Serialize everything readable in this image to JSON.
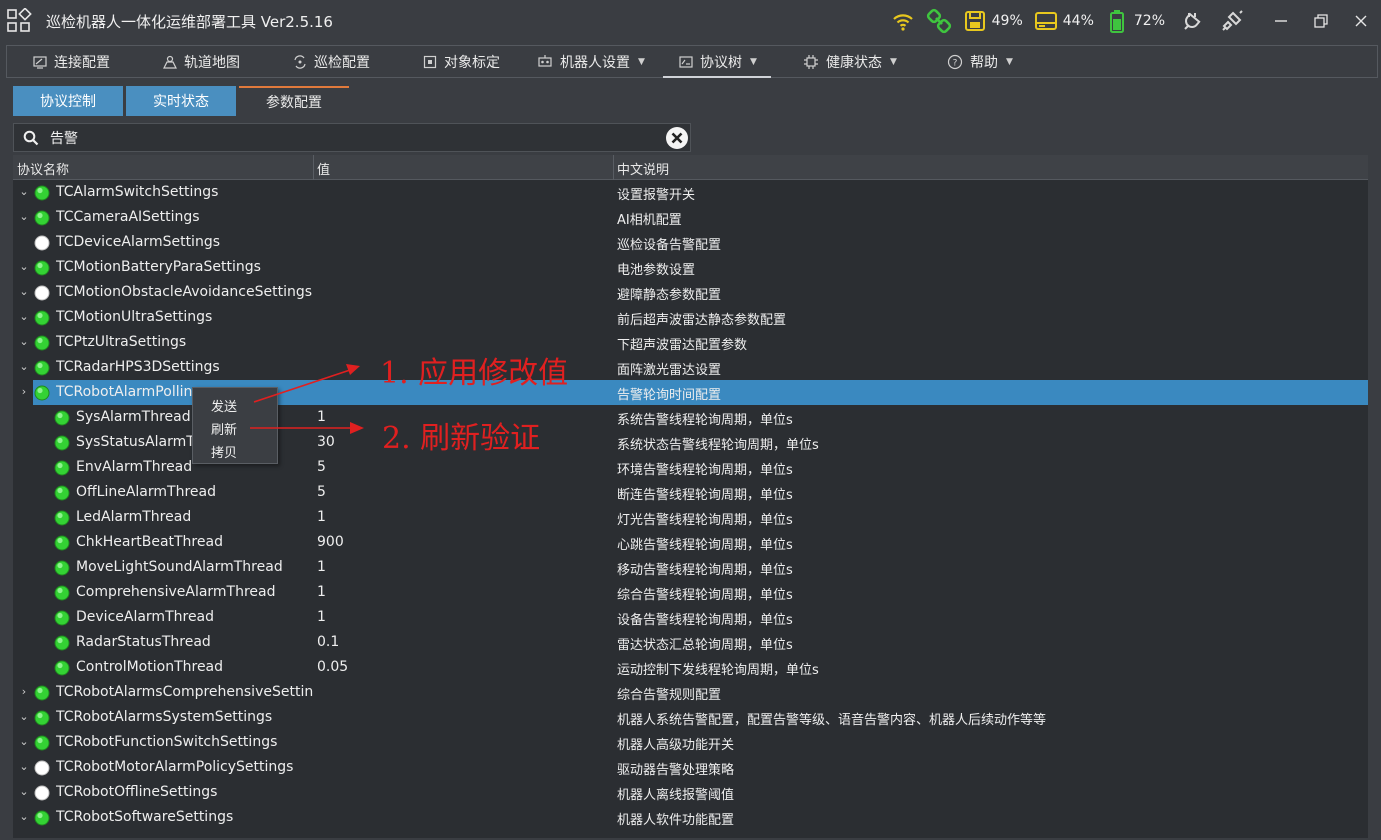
{
  "app": {
    "title": "巡检机器人一体化运维部署工具  Ver2.5.16",
    "logo_icon": "app-grid-logo-icon"
  },
  "status": {
    "wifi_icon": "wifi-signal-icon",
    "link_icon": "link-chain-icon",
    "disk_percent": "49%",
    "storage_percent": "44%",
    "battery_percent": "72%",
    "colors": {
      "green": "#3fc43f",
      "yellow": "#e8c81e",
      "gray": "#c8c8c8"
    }
  },
  "nav": [
    {
      "label": "连接配置",
      "icon": "connection-config-icon"
    },
    {
      "label": "轨道地图",
      "icon": "track-map-icon"
    },
    {
      "label": "巡检配置",
      "icon": "inspection-config-icon"
    },
    {
      "label": "对象标定",
      "icon": "object-calibration-icon"
    },
    {
      "label": "机器人设置",
      "icon": "robot-settings-icon"
    },
    {
      "label": "协议树",
      "icon": "protocol-tree-icon"
    },
    {
      "label": "健康状态",
      "icon": "health-status-icon"
    },
    {
      "label": "帮助",
      "icon": "help-icon"
    }
  ],
  "subtabs": [
    {
      "label": "协议控制"
    },
    {
      "label": "实时状态"
    },
    {
      "label": "参数配置"
    }
  ],
  "search": {
    "value": "告警",
    "placeholder": ""
  },
  "columns": {
    "name": "协议名称",
    "value": "值",
    "desc": "中文说明"
  },
  "rows": [
    {
      "level": 0,
      "expand": "down",
      "status": "green",
      "name": "TCAlarmSwitchSettings",
      "value": "",
      "desc": "设置报警开关"
    },
    {
      "level": 0,
      "expand": "down",
      "status": "green",
      "name": "TCCameraAISettings",
      "value": "",
      "desc": "AI相机配置"
    },
    {
      "level": 0,
      "expand": "",
      "status": "white",
      "name": "TCDeviceAlarmSettings",
      "value": "",
      "desc": "巡检设备告警配置"
    },
    {
      "level": 0,
      "expand": "down",
      "status": "green",
      "name": "TCMotionBatteryParaSettings",
      "value": "",
      "desc": "电池参数设置"
    },
    {
      "level": 0,
      "expand": "down",
      "status": "white",
      "name": "TCMotionObstacleAvoidanceSettings",
      "value": "",
      "desc": "避障静态参数配置"
    },
    {
      "level": 0,
      "expand": "down",
      "status": "green",
      "name": "TCMotionUltraSettings",
      "value": "",
      "desc": "前后超声波雷达静态参数配置"
    },
    {
      "level": 0,
      "expand": "down",
      "status": "green",
      "name": "TCPtzUltraSettings",
      "value": "",
      "desc": "下超声波雷达配置参数"
    },
    {
      "level": 0,
      "expand": "down",
      "status": "green",
      "name": "TCRadarHPS3DSettings",
      "value": "",
      "desc": "面阵激光雷达设置"
    },
    {
      "level": 0,
      "expand": "right",
      "status": "green",
      "name": "TCRobotAlarmPollin",
      "value": "",
      "desc": "告警轮询时间配置",
      "selected": true
    },
    {
      "level": 1,
      "expand": "",
      "status": "green",
      "name": "SysAlarmThread",
      "value": "1",
      "desc": "系统告警线程轮询周期，单位s"
    },
    {
      "level": 1,
      "expand": "",
      "status": "green",
      "name": "SysStatusAlarmTh",
      "value": "30",
      "desc": "系统状态告警线程轮询周期，单位s"
    },
    {
      "level": 1,
      "expand": "",
      "status": "green",
      "name": "EnvAlarmThread",
      "value": "5",
      "desc": "环境告警线程轮询周期，单位s"
    },
    {
      "level": 1,
      "expand": "",
      "status": "green",
      "name": "OffLineAlarmThread",
      "value": "5",
      "desc": "断连告警线程轮询周期，单位s"
    },
    {
      "level": 1,
      "expand": "",
      "status": "green",
      "name": "LedAlarmThread",
      "value": "1",
      "desc": "灯光告警线程轮询周期，单位s"
    },
    {
      "level": 1,
      "expand": "",
      "status": "green",
      "name": "ChkHeartBeatThread",
      "value": "900",
      "desc": "心跳告警线程轮询周期，单位s"
    },
    {
      "level": 1,
      "expand": "",
      "status": "green",
      "name": "MoveLightSoundAlarmThread",
      "value": "1",
      "desc": "移动告警线程轮询周期，单位s"
    },
    {
      "level": 1,
      "expand": "",
      "status": "green",
      "name": "ComprehensiveAlarmThread",
      "value": "1",
      "desc": "综合告警线程轮询周期，单位s"
    },
    {
      "level": 1,
      "expand": "",
      "status": "green",
      "name": "DeviceAlarmThread",
      "value": "1",
      "desc": "设备告警线程轮询周期，单位s"
    },
    {
      "level": 1,
      "expand": "",
      "status": "green",
      "name": "RadarStatusThread",
      "value": "0.1",
      "desc": "雷达状态汇总轮询周期，单位s"
    },
    {
      "level": 1,
      "expand": "",
      "status": "green",
      "name": "ControlMotionThread",
      "value": "0.05",
      "desc": "运动控制下发线程轮询周期，单位s"
    },
    {
      "level": 0,
      "expand": "right",
      "status": "green",
      "name": "TCRobotAlarmsComprehensiveSettings",
      "value": "",
      "desc": "综合告警规则配置"
    },
    {
      "level": 0,
      "expand": "down",
      "status": "green",
      "name": "TCRobotAlarmsSystemSettings",
      "value": "",
      "desc": "机器人系统告警配置，配置告警等级、语音告警内容、机器人后续动作等等"
    },
    {
      "level": 0,
      "expand": "down",
      "status": "green",
      "name": "TCRobotFunctionSwitchSettings",
      "value": "",
      "desc": "机器人高级功能开关"
    },
    {
      "level": 0,
      "expand": "down",
      "status": "white",
      "name": "TCRobotMotorAlarmPolicySettings",
      "value": "",
      "desc": "驱动器告警处理策略"
    },
    {
      "level": 0,
      "expand": "down",
      "status": "white",
      "name": "TCRobotOfflineSettings",
      "value": "",
      "desc": "机器人离线报警阈值"
    },
    {
      "level": 0,
      "expand": "down",
      "status": "green",
      "name": "TCRobotSoftwareSettings",
      "value": "",
      "desc": "机器人软件功能配置"
    }
  ],
  "context_menu": {
    "items": [
      "发送",
      "刷新",
      "拷贝"
    ]
  },
  "annotations": [
    {
      "text": "1. 应用修改值",
      "color": "#e02020"
    },
    {
      "text": "2. 刷新验证",
      "color": "#e02020"
    }
  ]
}
